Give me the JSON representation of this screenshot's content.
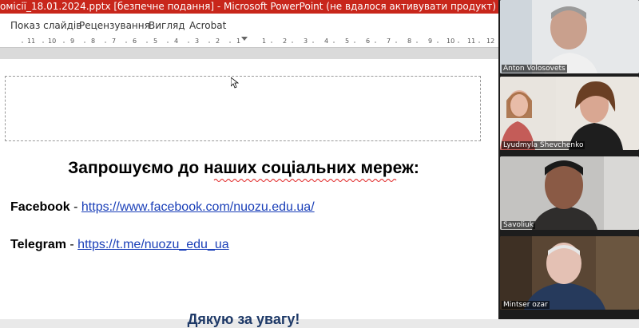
{
  "window": {
    "title": "омісії_18.01.2024.pptx [безпечне подання] - Microsoft PowerPoint (не вдалося активувати продукт)"
  },
  "ribbon": {
    "tabs": [
      {
        "label": "Показ слайдів"
      },
      {
        "label": "Рецензування"
      },
      {
        "label": "Вигляд"
      },
      {
        "label": "Acrobat"
      }
    ]
  },
  "ruler": {
    "labels": [
      "11",
      "10",
      "9",
      "8",
      "7",
      "6",
      "5",
      "4",
      "3",
      "2",
      "1",
      "1",
      "2",
      "3",
      "4",
      "5",
      "6",
      "7",
      "8",
      "9",
      "10",
      "11",
      "12"
    ]
  },
  "slide": {
    "heading": "Запрошуємо до наших соціальних мереж:",
    "facebook": {
      "label": "Facebook",
      "sep": " - ",
      "url": "https://www.facebook.com/nuozu.edu.ua/"
    },
    "telegram": {
      "label": "Telegram",
      "sep": " - ",
      "url": "https://t.me/nuozu_edu_ua"
    },
    "thanks": "Дякую за увагу!"
  },
  "participants": [
    {
      "name": "Anton Volosovets"
    },
    {
      "name": "Lyudmyla Shevchenko"
    },
    {
      "name": "Savoliuk"
    },
    {
      "name": "Mintser ozar"
    }
  ],
  "colors": {
    "titlebar": "#c8261b",
    "link": "#1a3fb8",
    "thanks": "#1f3a68"
  }
}
